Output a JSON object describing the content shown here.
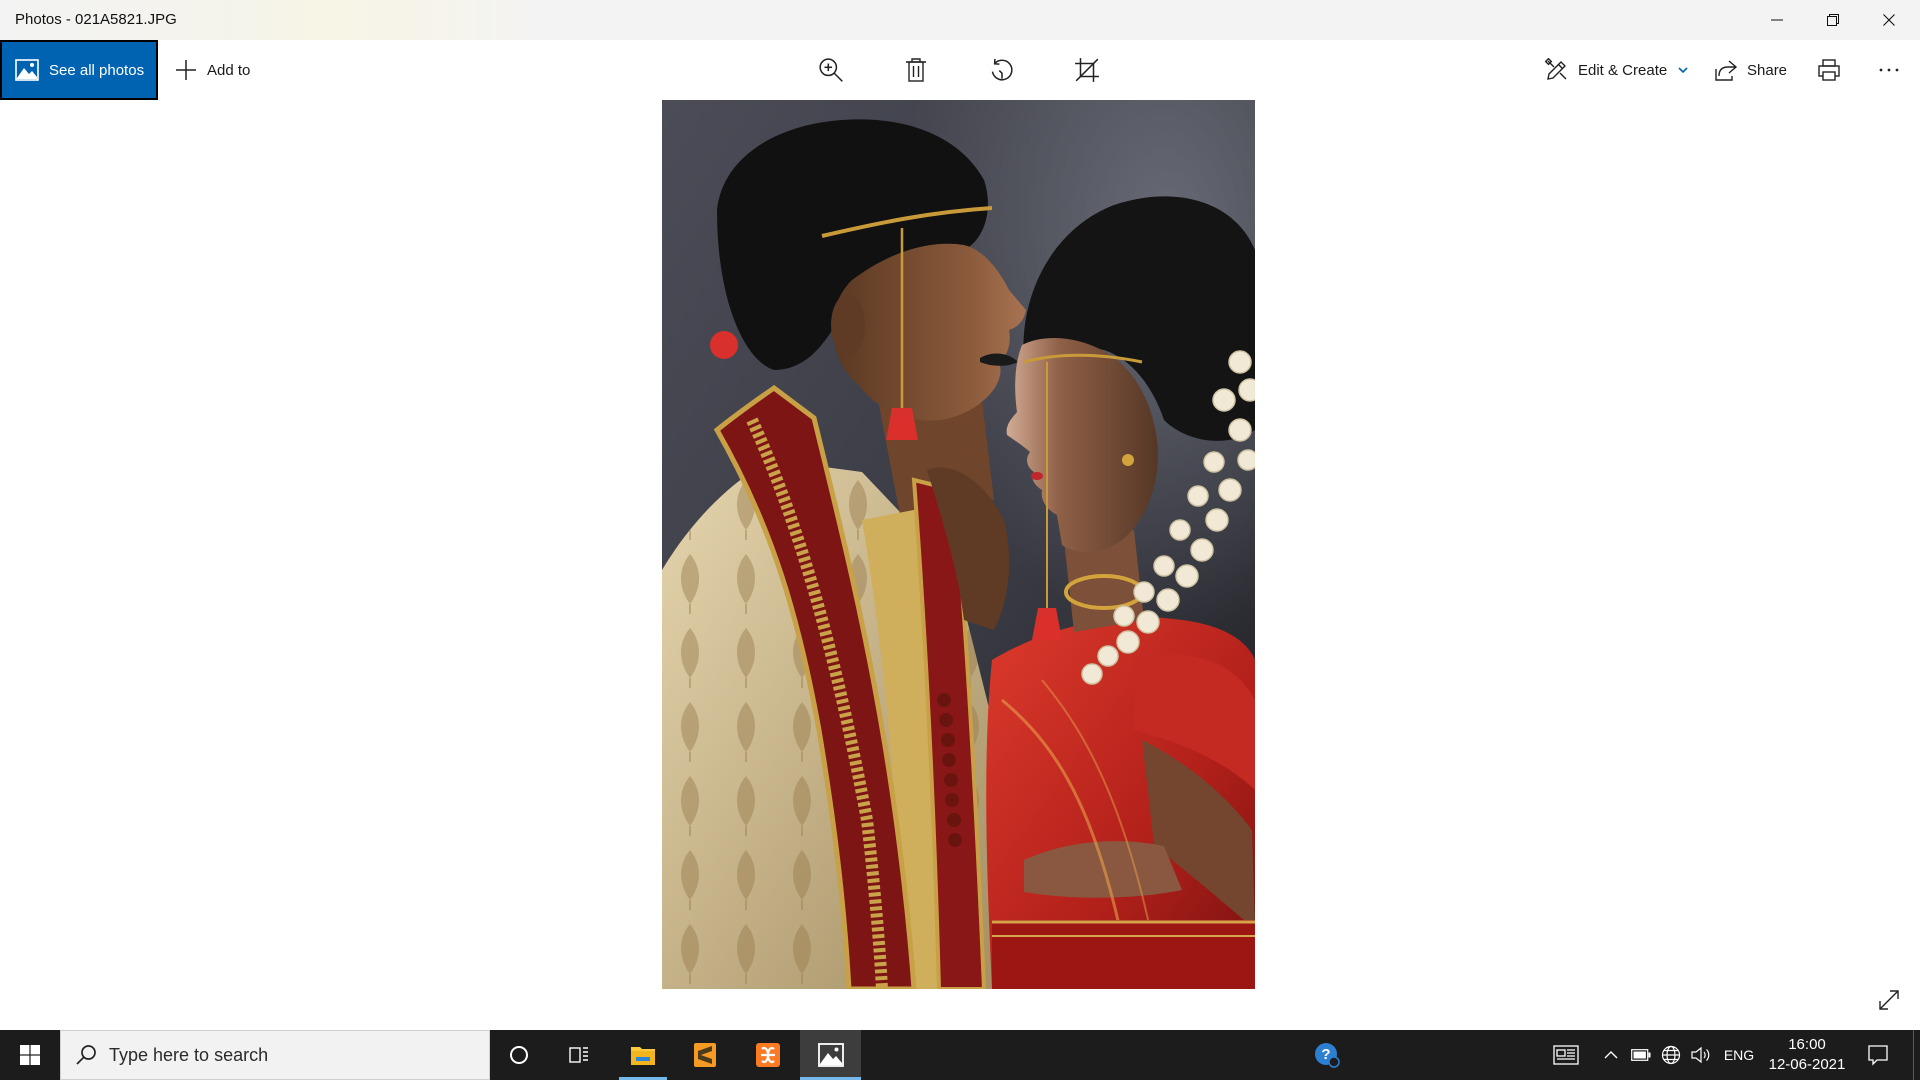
{
  "window": {
    "title": "Photos - 021A5821.JPG",
    "controls": {
      "minimize_icon": "minimize-icon",
      "restore_icon": "restore-icon",
      "close_icon": "close-icon"
    }
  },
  "toolbar": {
    "see_all_photos": {
      "label": "See all photos",
      "icon": "photos-icon"
    },
    "add_to": {
      "label": "Add to",
      "icon": "plus-icon"
    },
    "tools": [
      {
        "icon": "zoom-in-icon"
      },
      {
        "icon": "delete-icon"
      },
      {
        "icon": "rotate-icon"
      },
      {
        "icon": "crop-icon"
      }
    ],
    "edit_create": {
      "label": "Edit & Create",
      "icon": "edit-create-icon",
      "dropdown_icon": "chevron-down-icon"
    },
    "share": {
      "label": "Share",
      "icon": "share-icon"
    },
    "print": {
      "icon": "print-icon"
    },
    "more": {
      "icon": "more-icon"
    }
  },
  "viewer": {
    "image": "wedding-couple-photo",
    "full_screen_icon": "full-screen-icon"
  },
  "taskbar": {
    "start_icon": "windows-start-icon",
    "search": {
      "placeholder": "Type here to search",
      "icon": "search-icon"
    },
    "cortana_icon": "cortana-icon",
    "task_view_icon": "task-view-icon",
    "apps": [
      {
        "icon": "file-explorer-icon",
        "running": true,
        "active": false
      },
      {
        "icon": "sublime-text-icon",
        "running": false,
        "active": false
      },
      {
        "icon": "xampp-icon",
        "running": false,
        "active": false
      },
      {
        "icon": "photos-app-icon",
        "running": true,
        "active": true
      }
    ],
    "tray": {
      "help_icon": "help-icon",
      "news_icon": "news-icon",
      "overflow_icon": "chevron-up-icon",
      "battery_icon": "battery-icon",
      "network_icon": "globe-icon",
      "volume_icon": "volume-icon",
      "language": "ENG",
      "time": "16:00",
      "date": "12-06-2021",
      "notifications_icon": "notification-icon"
    }
  },
  "colors": {
    "accent": "#0063b1",
    "titlebar_bg": "#f3f3f3",
    "taskbar_bg": "#1c1c1c",
    "running_indicator": "#76b9ed"
  }
}
